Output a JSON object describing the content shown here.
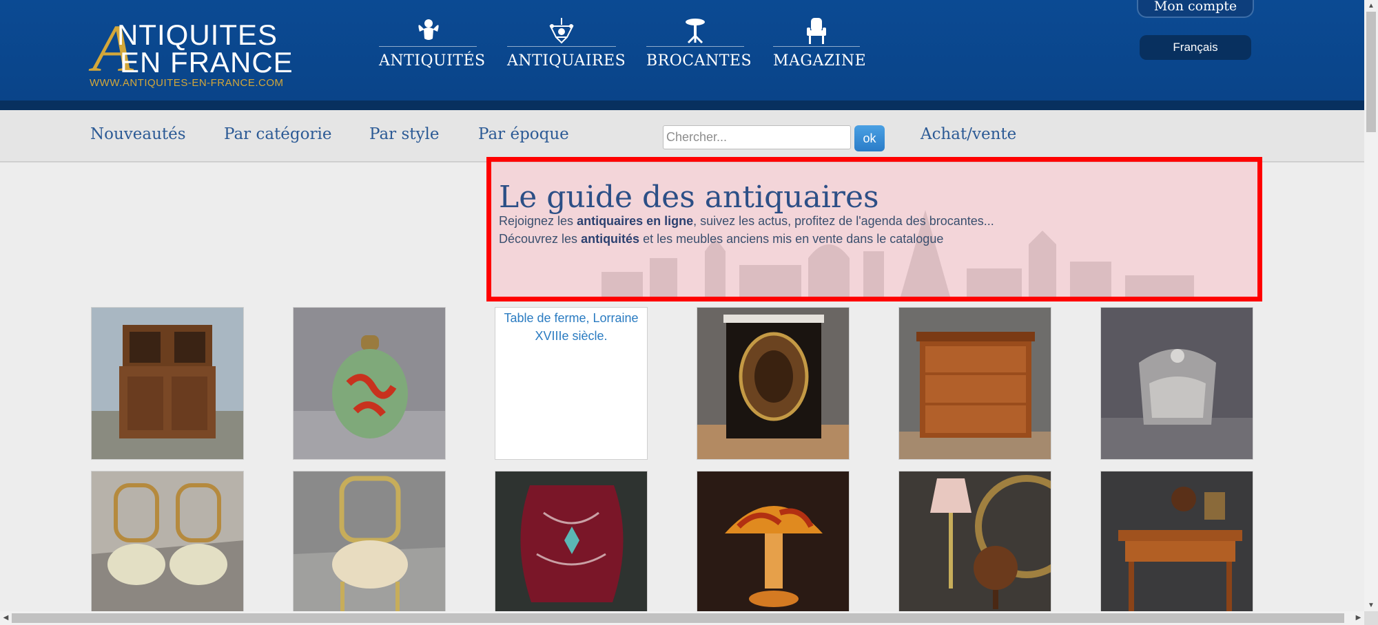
{
  "header": {
    "logo": {
      "letter": "A",
      "line1": "NTIQUITES",
      "line2": "EN FRANCE",
      "url": "WWW.ANTIQUITES-EN-FRANCE.COM"
    },
    "nav": [
      {
        "label": "ANTIQUITÉS",
        "icon": "cherub-icon"
      },
      {
        "label": "ANTIQUAIRES",
        "icon": "chandelier-icon"
      },
      {
        "label": "BROCANTES",
        "icon": "pedestal-table-icon"
      },
      {
        "label": "MAGAZINE",
        "icon": "armchair-icon"
      }
    ],
    "account_label": "Mon compte",
    "language": "Français"
  },
  "subnav": {
    "links": [
      "Nouveautés",
      "Par catégorie",
      "Par style",
      "Par époque"
    ],
    "search_placeholder": "Chercher...",
    "search_button": "ok",
    "buy_sell": "Achat/vente"
  },
  "guide": {
    "title": "Le guide des antiquaires",
    "line1_pre": "Rejoignez les ",
    "line1_bold": "antiquaires en ligne",
    "line1_post": ", suivez les actus, profitez de l'agenda des brocantes...",
    "line2_pre": "Découvrez les ",
    "line2_bold": "antiquités",
    "line2_post": " et les meubles anciens mis en vente dans le catalogue"
  },
  "products": {
    "broken_alt": "Table de ferme, Lorraine XVIIIe siècle."
  },
  "colors": {
    "header_blue": "#0b4a93",
    "gold": "#d3a73a",
    "link_blue": "#2c5a95",
    "highlight_border": "#ff0000"
  }
}
